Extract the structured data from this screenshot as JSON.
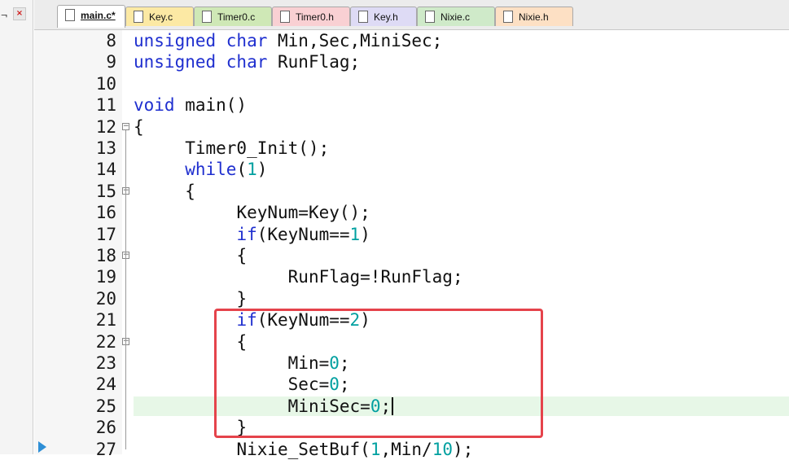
{
  "window_controls": {
    "pin_glyph": "\t",
    "close_glyph": "×"
  },
  "tabs": [
    {
      "label": "main.c*",
      "active": true
    },
    {
      "label": "Key.c"
    },
    {
      "label": "Timer0.c"
    },
    {
      "label": "Timer0.h"
    },
    {
      "label": "Key.h"
    },
    {
      "label": "Nixie.c"
    },
    {
      "label": "Nixie.h"
    }
  ],
  "lines": [
    {
      "n": "8",
      "indent": "",
      "parts": [
        [
          "kw",
          "unsigned char"
        ],
        [
          "t",
          " Min,Sec,MiniSec;"
        ]
      ]
    },
    {
      "n": "9",
      "indent": "",
      "parts": [
        [
          "kw",
          "unsigned char"
        ],
        [
          "t",
          " RunFlag;"
        ]
      ]
    },
    {
      "n": "10",
      "indent": "",
      "parts": []
    },
    {
      "n": "11",
      "indent": "",
      "parts": [
        [
          "kw",
          "void"
        ],
        [
          "t",
          " main()"
        ]
      ]
    },
    {
      "n": "12",
      "indent": "",
      "parts": [
        [
          "t",
          "{"
        ]
      ],
      "fold": "−"
    },
    {
      "n": "13",
      "indent": "     ",
      "parts": [
        [
          "t",
          "Timer0_Init();"
        ]
      ]
    },
    {
      "n": "14",
      "indent": "     ",
      "parts": [
        [
          "kw",
          "while"
        ],
        [
          "t",
          "("
        ],
        [
          "num",
          "1"
        ],
        [
          "t",
          ")"
        ]
      ]
    },
    {
      "n": "15",
      "indent": "     ",
      "parts": [
        [
          "t",
          "{"
        ]
      ],
      "fold": "−"
    },
    {
      "n": "16",
      "indent": "          ",
      "parts": [
        [
          "t",
          "KeyNum=Key();"
        ]
      ]
    },
    {
      "n": "17",
      "indent": "          ",
      "parts": [
        [
          "kw",
          "if"
        ],
        [
          "t",
          "(KeyNum=="
        ],
        [
          "num",
          "1"
        ],
        [
          "t",
          ")"
        ]
      ]
    },
    {
      "n": "18",
      "indent": "          ",
      "parts": [
        [
          "t",
          "{"
        ]
      ],
      "fold": "−"
    },
    {
      "n": "19",
      "indent": "               ",
      "parts": [
        [
          "t",
          "RunFlag=!RunFlag;"
        ]
      ]
    },
    {
      "n": "20",
      "indent": "          ",
      "parts": [
        [
          "t",
          "}"
        ]
      ]
    },
    {
      "n": "21",
      "indent": "          ",
      "parts": [
        [
          "kw",
          "if"
        ],
        [
          "t",
          "(KeyNum=="
        ],
        [
          "num",
          "2"
        ],
        [
          "t",
          ")"
        ]
      ]
    },
    {
      "n": "22",
      "indent": "          ",
      "parts": [
        [
          "t",
          "{"
        ]
      ],
      "fold": "−"
    },
    {
      "n": "23",
      "indent": "               ",
      "parts": [
        [
          "t",
          "Min="
        ],
        [
          "num",
          "0"
        ],
        [
          "t",
          ";"
        ]
      ]
    },
    {
      "n": "24",
      "indent": "               ",
      "parts": [
        [
          "t",
          "Sec="
        ],
        [
          "num",
          "0"
        ],
        [
          "t",
          ";"
        ]
      ]
    },
    {
      "n": "25",
      "indent": "               ",
      "parts": [
        [
          "t",
          "MiniSec="
        ],
        [
          "num",
          "0"
        ],
        [
          "t",
          ";"
        ]
      ],
      "current": true
    },
    {
      "n": "26",
      "indent": "          ",
      "parts": [
        [
          "t",
          "}"
        ]
      ]
    },
    {
      "n": "27",
      "indent": "          ",
      "parts": [
        [
          "t",
          "Nixie_SetBuf("
        ],
        [
          "num",
          "1"
        ],
        [
          "t",
          ",Min/"
        ],
        [
          "num",
          "10"
        ],
        [
          "t",
          ");"
        ]
      ]
    }
  ],
  "colors": {
    "keyword": "#1f2fcf",
    "number": "#00a0a0",
    "current_line": "#e7f7e7",
    "annotation_box": "#e5434b"
  }
}
